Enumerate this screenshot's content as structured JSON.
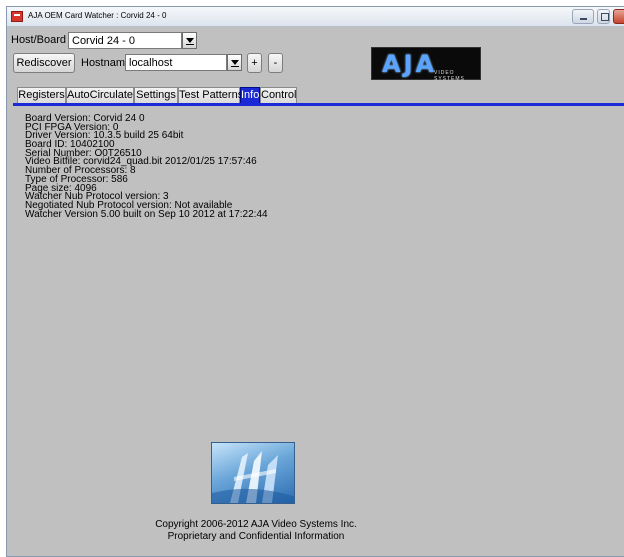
{
  "window": {
    "title": "AJA OEM Card Watcher : Corvid 24 - 0"
  },
  "host": {
    "label": "Host/Board :",
    "value": "Corvid 24 - 0",
    "rediscover_label": "Rediscover",
    "hostname_label": "Hostname",
    "hostname_value": "localhost",
    "add_label": "+",
    "remove_label": "-"
  },
  "logo": {
    "mark": "AJA",
    "subtext": "VIDEO SYSTEMS"
  },
  "tabs": [
    {
      "label": "Registers",
      "active": false
    },
    {
      "label": "AutoCirculate",
      "active": false
    },
    {
      "label": "Settings",
      "active": false
    },
    {
      "label": "Test Patterns",
      "active": false
    },
    {
      "label": "Info",
      "active": true
    },
    {
      "label": "Control",
      "active": false
    }
  ],
  "info": [
    "Board Version: Corvid 24 0",
    "PCI FPGA Version: 0",
    "Driver Version: 10.3.5 build 25 64bit",
    "Board ID: 10402100",
    "Serial Number: O0T26510",
    "Video Bitfile: corvid24_quad.bit 2012/01/25 17:57:46",
    "Number of Processors: 8",
    "Type of Processor: 586",
    "Page size: 4096",
    "Watcher Nub Protocol version: 3",
    "Negotiated Nub Protocol version:  Not available",
    "Watcher Version 5.00 built on Sep 10 2012 at 17:22:44"
  ],
  "footer": {
    "copyright": "Copyright 2006-2012 AJA Video Systems Inc.",
    "notice": "Proprietary and Confidential Information"
  },
  "icons": {
    "app": "aja-app-icon",
    "emblem": "aja-building-emblem"
  },
  "colors": {
    "tab_active": "#1b2ad6",
    "window_bg": "#c0c0c0"
  }
}
